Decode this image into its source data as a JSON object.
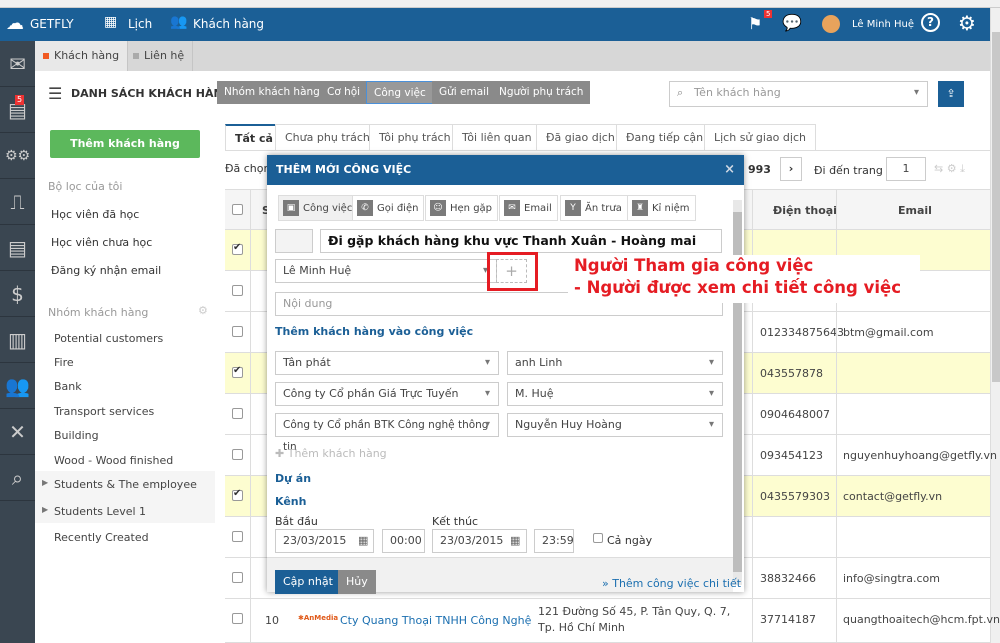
{
  "topbar": {
    "brand": "GETFLY",
    "nav": [
      "Lịch",
      "Khách hàng"
    ],
    "flag_count": "5",
    "user": "Lê Minh Huệ",
    "help": "?"
  },
  "leftnav": {
    "badge": "5",
    "icons": [
      "mail-icon",
      "task-icon",
      "network-icon",
      "presentation-icon",
      "news-icon",
      "money-bag-icon",
      "library-icon",
      "users-icon",
      "graph-icon",
      "search-icon"
    ]
  },
  "subtabs": [
    "Khách hàng",
    "Liên hệ"
  ],
  "header": {
    "title": "DANH SÁCH KHÁCH HÀNG",
    "buttons": [
      "Nhóm khách hàng",
      "Cơ hội",
      "Công việc",
      "Gửi email",
      "Người phụ trách"
    ],
    "search_placeholder": "Tên khách hàng"
  },
  "sidebar": {
    "add_button": "Thêm khách hàng",
    "filters_title": "Bộ lọc của tôi",
    "filters": [
      "Học viên đã học",
      "Học viên chưa học",
      "Đăng ký nhận email"
    ],
    "groups_title": "Nhóm khách hàng",
    "groups": [
      "Potential customers",
      "Fire",
      "Bank",
      "Transport services",
      "Building",
      "Wood - Wood finished",
      "Students & The employee",
      "Students Level 1",
      "Recently Created"
    ]
  },
  "tabs": [
    "Tất cả",
    "Chưa phụ trách",
    "Tôi phụ trách",
    "Tôi liên quan",
    "Đã giao dịch",
    "Đang tiếp cận",
    "Lịch sử giao dịch"
  ],
  "toolbar": {
    "selected": "Đã chọn",
    "total": "993",
    "goto": "Đi đến trang",
    "page": "1"
  },
  "table": {
    "headers": {
      "stt": "S",
      "phone": "Điện thoại",
      "email": "Email"
    },
    "rows": [
      {
        "checked": true,
        "phone": "",
        "email": ""
      },
      {
        "checked": false,
        "phone": "",
        "email": ""
      },
      {
        "checked": false,
        "phone": "012334875643",
        "email": "btm@gmail.com"
      },
      {
        "checked": true,
        "phone": "043557878",
        "email": ""
      },
      {
        "checked": false,
        "phone": "0904648007",
        "email": ""
      },
      {
        "checked": false,
        "phone": "093454123",
        "email": "nguyenhuyhoang@getfly.vn"
      },
      {
        "checked": true,
        "phone": "0435579303",
        "email": "contact@getfly.vn"
      },
      {
        "checked": false,
        "phone": "",
        "email": ""
      },
      {
        "checked": false,
        "phone": "38832466",
        "email": "info@singtra.com"
      },
      {
        "checked": false,
        "stt": "10",
        "name": "Cty Quang Thoại TNHH Công Nghệ",
        "address": "121 Đường Số 45, P. Tân Quy, Q. 7, Tp. Hồ Chí Minh",
        "phone": "37714187",
        "email": "quangthoaitech@hcm.fpt.vn"
      }
    ]
  },
  "modal": {
    "title": "THÊM MỚI CÔNG VIỆC",
    "types": [
      "Công việc",
      "Gọi điện",
      "Hẹn gặp",
      "Email",
      "Ăn trưa",
      "Kỉ niệm"
    ],
    "task_name": "Đi gặp khách hàng khu vực Thanh Xuân - Hoàng mai",
    "assignee": "Lê Minh Huệ",
    "content_placeholder": "Nội dung",
    "add_customer_title": "Thêm khách hàng vào công việc",
    "customers": [
      {
        "company": "Tân phát",
        "contact": "anh Linh"
      },
      {
        "company": "Công ty Cổ phần Giá Trực Tuyến",
        "contact": "M. Huệ"
      },
      {
        "company": "Công ty Cổ phần BTK Công nghệ thông tin",
        "contact": "Nguyễn Huy Hoàng"
      }
    ],
    "add_customer": "Thêm khách hàng",
    "project": "Dự án",
    "channel": "Kênh",
    "start_label": "Bắt đầu",
    "start_date": "23/03/2015",
    "start_time": "00:00",
    "end_label": "Kết thúc",
    "end_date": "23/03/2015",
    "end_time": "23:59",
    "all_day": "Cả ngày",
    "save": "Cập nhật",
    "cancel": "Hủy",
    "detail_link": "» Thêm công việc chi tiết"
  },
  "annotation": {
    "line1": "Người Tham gia công việc",
    "line2": "- Người được xem chi tiết công việc",
    "color": "#e51c23"
  }
}
